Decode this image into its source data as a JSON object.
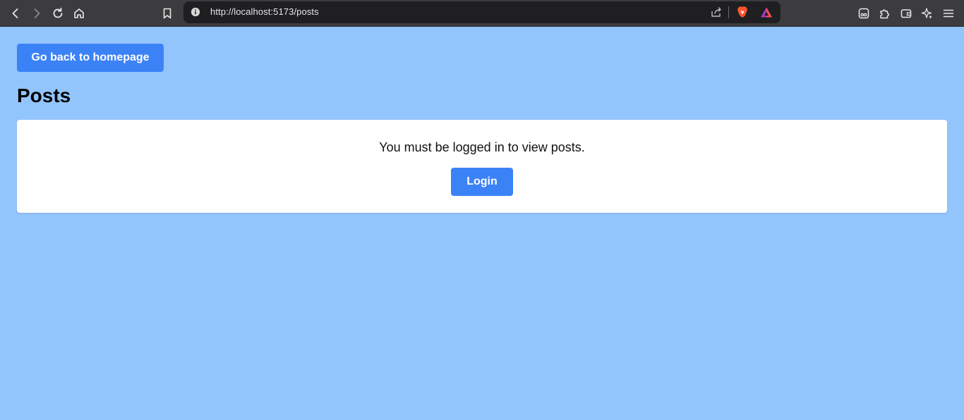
{
  "browser": {
    "url": "http://localhost:5173/posts",
    "icons": [
      "back-icon",
      "forward-icon",
      "reload-icon",
      "home-icon",
      "bookmark-icon",
      "site-info-icon",
      "share-icon",
      "brave-shields-icon",
      "brave-rewards-icon",
      "leo-icon",
      "extensions-icon",
      "wallet-icon",
      "ai-assistant-icon",
      "menu-icon"
    ]
  },
  "page": {
    "back_button_label": "Go back to homepage",
    "title": "Posts",
    "message": "You must be logged in to view posts.",
    "login_button_label": "Login"
  },
  "colors": {
    "background": "#93c5fd",
    "button": "#3b82f6",
    "card": "#ffffff",
    "toolbar": "#3c3c3f"
  }
}
